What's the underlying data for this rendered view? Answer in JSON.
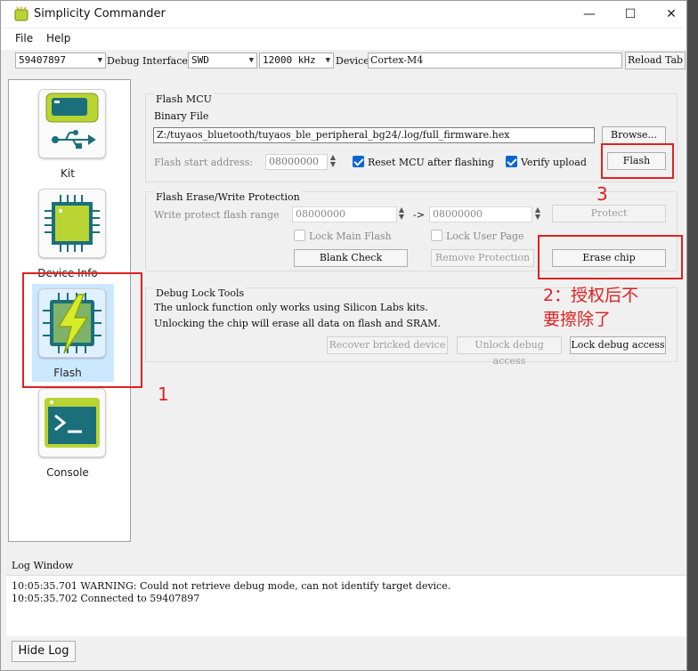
{
  "window": {
    "title": "Simplicity Commander",
    "minimize_glyph": "—",
    "maximize_glyph": "☐",
    "close_glyph": "✕"
  },
  "menu": {
    "items": [
      "File",
      "Help"
    ]
  },
  "toolbar": {
    "device_serial": "59407897",
    "debug_interface_label": "Debug Interface",
    "debug_interface_value": "SWD",
    "speed_value": "12000 kHz",
    "device_label": "Device",
    "device_value": "Cortex-M4",
    "reload_tab_label": "Reload Tab"
  },
  "nav": {
    "items": [
      {
        "label": "Kit",
        "icon": "usb-kit-icon"
      },
      {
        "label": "Device Info",
        "icon": "chip-icon"
      },
      {
        "label": "Flash",
        "icon": "flash-chip-icon",
        "selected": true
      },
      {
        "label": "Console",
        "icon": "console-icon"
      }
    ]
  },
  "flash_mcu": {
    "title": "Flash MCU",
    "binary_file_label": "Binary File",
    "binary_file_path": "Z:/tuyaos_bluetooth/tuyaos_ble_peripheral_bg24/.log/full_firmware.hex",
    "browse_label": "Browse...",
    "start_address_label": "Flash start address:",
    "start_address_value": "08000000",
    "reset_mcu_label": "Reset MCU after flashing",
    "reset_mcu_checked": true,
    "verify_upload_label": "Verify upload",
    "verify_upload_checked": true,
    "flash_button_label": "Flash"
  },
  "erase_protect": {
    "title": "Flash Erase/Write Protection",
    "write_protect_label": "Write protect flash range",
    "range_start": "08000000",
    "range_arrow": "->",
    "range_end": "08000000",
    "protect_label": "Protect",
    "lock_main_flash_label": "Lock Main Flash",
    "lock_user_page_label": "Lock User Page",
    "blank_check_label": "Blank Check",
    "remove_protection_label": "Remove Protection",
    "erase_chip_label": "Erase chip"
  },
  "debug_lock": {
    "title": "Debug Lock Tools",
    "line1": "The unlock function only works using Silicon Labs kits.",
    "line2": "Unlocking the chip will erase all data on flash and SRAM.",
    "recover_label": "Recover bricked device",
    "unlock_label": "Unlock debug access",
    "lock_label": "Lock debug access"
  },
  "annotations": {
    "step1": "1",
    "step2": "2：授权后不要擦除了",
    "step2_line1": "2：授权后不",
    "step2_line2": "要擦除了",
    "step3": "3",
    "color": "#e02020"
  },
  "log": {
    "title": "Log Window",
    "lines": [
      "10:05:35.701 WARNING: Could not retrieve debug mode, can not identify target device.",
      "10:05:35.702 Connected to 59407897"
    ],
    "hide_log_label": "Hide Log"
  },
  "colors": {
    "accent_blue": "#0a64d2",
    "selection": "#cce8ff",
    "tile_green": "#b7d433"
  }
}
